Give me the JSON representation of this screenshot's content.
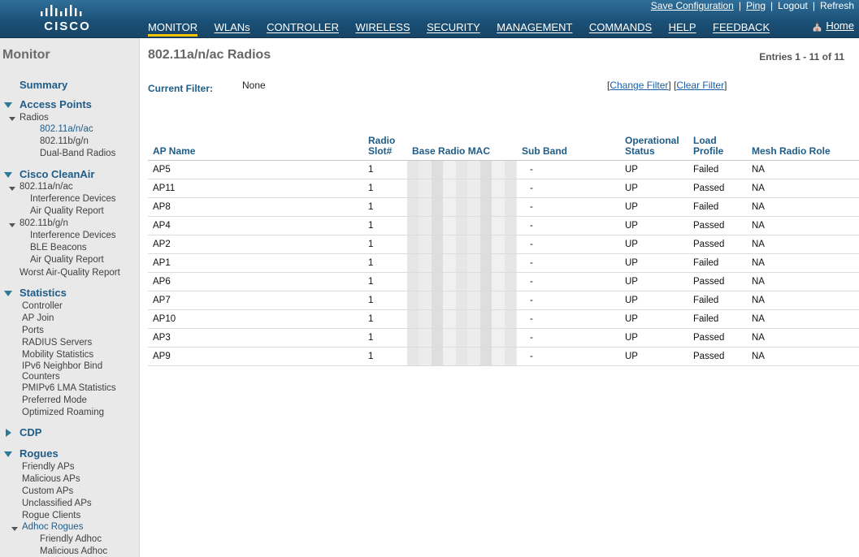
{
  "brand": {
    "logo_text": "CISCO"
  },
  "utility_links": [
    "Save Configuration",
    "Ping",
    "Logout",
    "Refresh"
  ],
  "nav": {
    "items": [
      "MONITOR",
      "WLANs",
      "CONTROLLER",
      "WIRELESS",
      "SECURITY",
      "MANAGEMENT",
      "COMMANDS",
      "HELP",
      "FEEDBACK"
    ],
    "active": "MONITOR",
    "home": "Home"
  },
  "sidebar": {
    "title": "Monitor",
    "summary": "Summary",
    "access_points": "Access Points",
    "radios": "Radios",
    "radio_80211anac": "802.11a/n/ac",
    "radio_80211bgn": "802.11b/g/n",
    "dual_band": "Dual-Band Radios",
    "cleanair": "Cisco CleanAir",
    "ca_anac": "802.11a/n/ac",
    "ca_anac_interference": "Interference Devices",
    "ca_anac_aqr": "Air Quality Report",
    "ca_bgn": "802.11b/g/n",
    "ca_bgn_interference": "Interference Devices",
    "ca_bgn_ble": "BLE Beacons",
    "ca_bgn_aqr": "Air Quality Report",
    "worst_aqr": "Worst Air-Quality Report",
    "statistics": "Statistics",
    "stats_controller": "Controller",
    "stats_ap_join": "AP Join",
    "stats_ports": "Ports",
    "stats_radius": "RADIUS Servers",
    "stats_mobility": "Mobility Statistics",
    "stats_ipv6_line1": "IPv6 Neighbor Bind",
    "stats_ipv6_line2": "Counters",
    "stats_pmipv6": "PMIPv6 LMA Statistics",
    "stats_preferred": "Preferred Mode",
    "stats_roaming": "Optimized Roaming",
    "cdp": "CDP",
    "rogues": "Rogues",
    "rogue_friendly": "Friendly APs",
    "rogue_malicious": "Malicious APs",
    "rogue_custom": "Custom APs",
    "rogue_unclassified": "Unclassified APs",
    "rogue_clients": "Rogue Clients",
    "adhoc": "Adhoc Rogues",
    "adhoc_friendly": "Friendly Adhoc",
    "adhoc_malicious": "Malicious Adhoc"
  },
  "main": {
    "title": "802.11a/n/ac Radios",
    "entries": "Entries 1 - 11 of 11",
    "filter_label": "Current Filter:",
    "filter_value": "None",
    "change_filter": "Change Filter",
    "clear_filter": "Clear Filter",
    "columns": {
      "ap_name": "AP Name",
      "slot_l1": "Radio",
      "slot_l2": "Slot#",
      "mac": "Base Radio MAC",
      "sub_band": "Sub Band",
      "op_l1": "Operational",
      "op_l2": "Status",
      "load_l1": "Load",
      "load_l2": "Profile",
      "mesh": "Mesh Radio Role"
    },
    "rows": [
      {
        "ap": "AP5",
        "slot": "1",
        "sub": "-",
        "op": "UP",
        "load": "Failed",
        "mesh": "NA"
      },
      {
        "ap": "AP11",
        "slot": "1",
        "sub": "-",
        "op": "UP",
        "load": "Passed",
        "mesh": "NA"
      },
      {
        "ap": "AP8",
        "slot": "1",
        "sub": "-",
        "op": "UP",
        "load": "Failed",
        "mesh": "NA"
      },
      {
        "ap": "AP4",
        "slot": "1",
        "sub": "-",
        "op": "UP",
        "load": "Passed",
        "mesh": "NA"
      },
      {
        "ap": "AP2",
        "slot": "1",
        "sub": "-",
        "op": "UP",
        "load": "Passed",
        "mesh": "NA"
      },
      {
        "ap": "AP1",
        "slot": "1",
        "sub": "-",
        "op": "UP",
        "load": "Failed",
        "mesh": "NA"
      },
      {
        "ap": "AP6",
        "slot": "1",
        "sub": "-",
        "op": "UP",
        "load": "Passed",
        "mesh": "NA"
      },
      {
        "ap": "AP7",
        "slot": "1",
        "sub": "-",
        "op": "UP",
        "load": "Failed",
        "mesh": "NA"
      },
      {
        "ap": "AP10",
        "slot": "1",
        "sub": "-",
        "op": "UP",
        "load": "Failed",
        "mesh": "NA"
      },
      {
        "ap": "AP3",
        "slot": "1",
        "sub": "-",
        "op": "UP",
        "load": "Passed",
        "mesh": "NA"
      },
      {
        "ap": "AP9",
        "slot": "1",
        "sub": "-",
        "op": "UP",
        "load": "Passed",
        "mesh": "NA"
      }
    ]
  },
  "colors": {
    "header": "#1a4f75",
    "accent": "#f6c300",
    "link": "#1f5c87"
  }
}
